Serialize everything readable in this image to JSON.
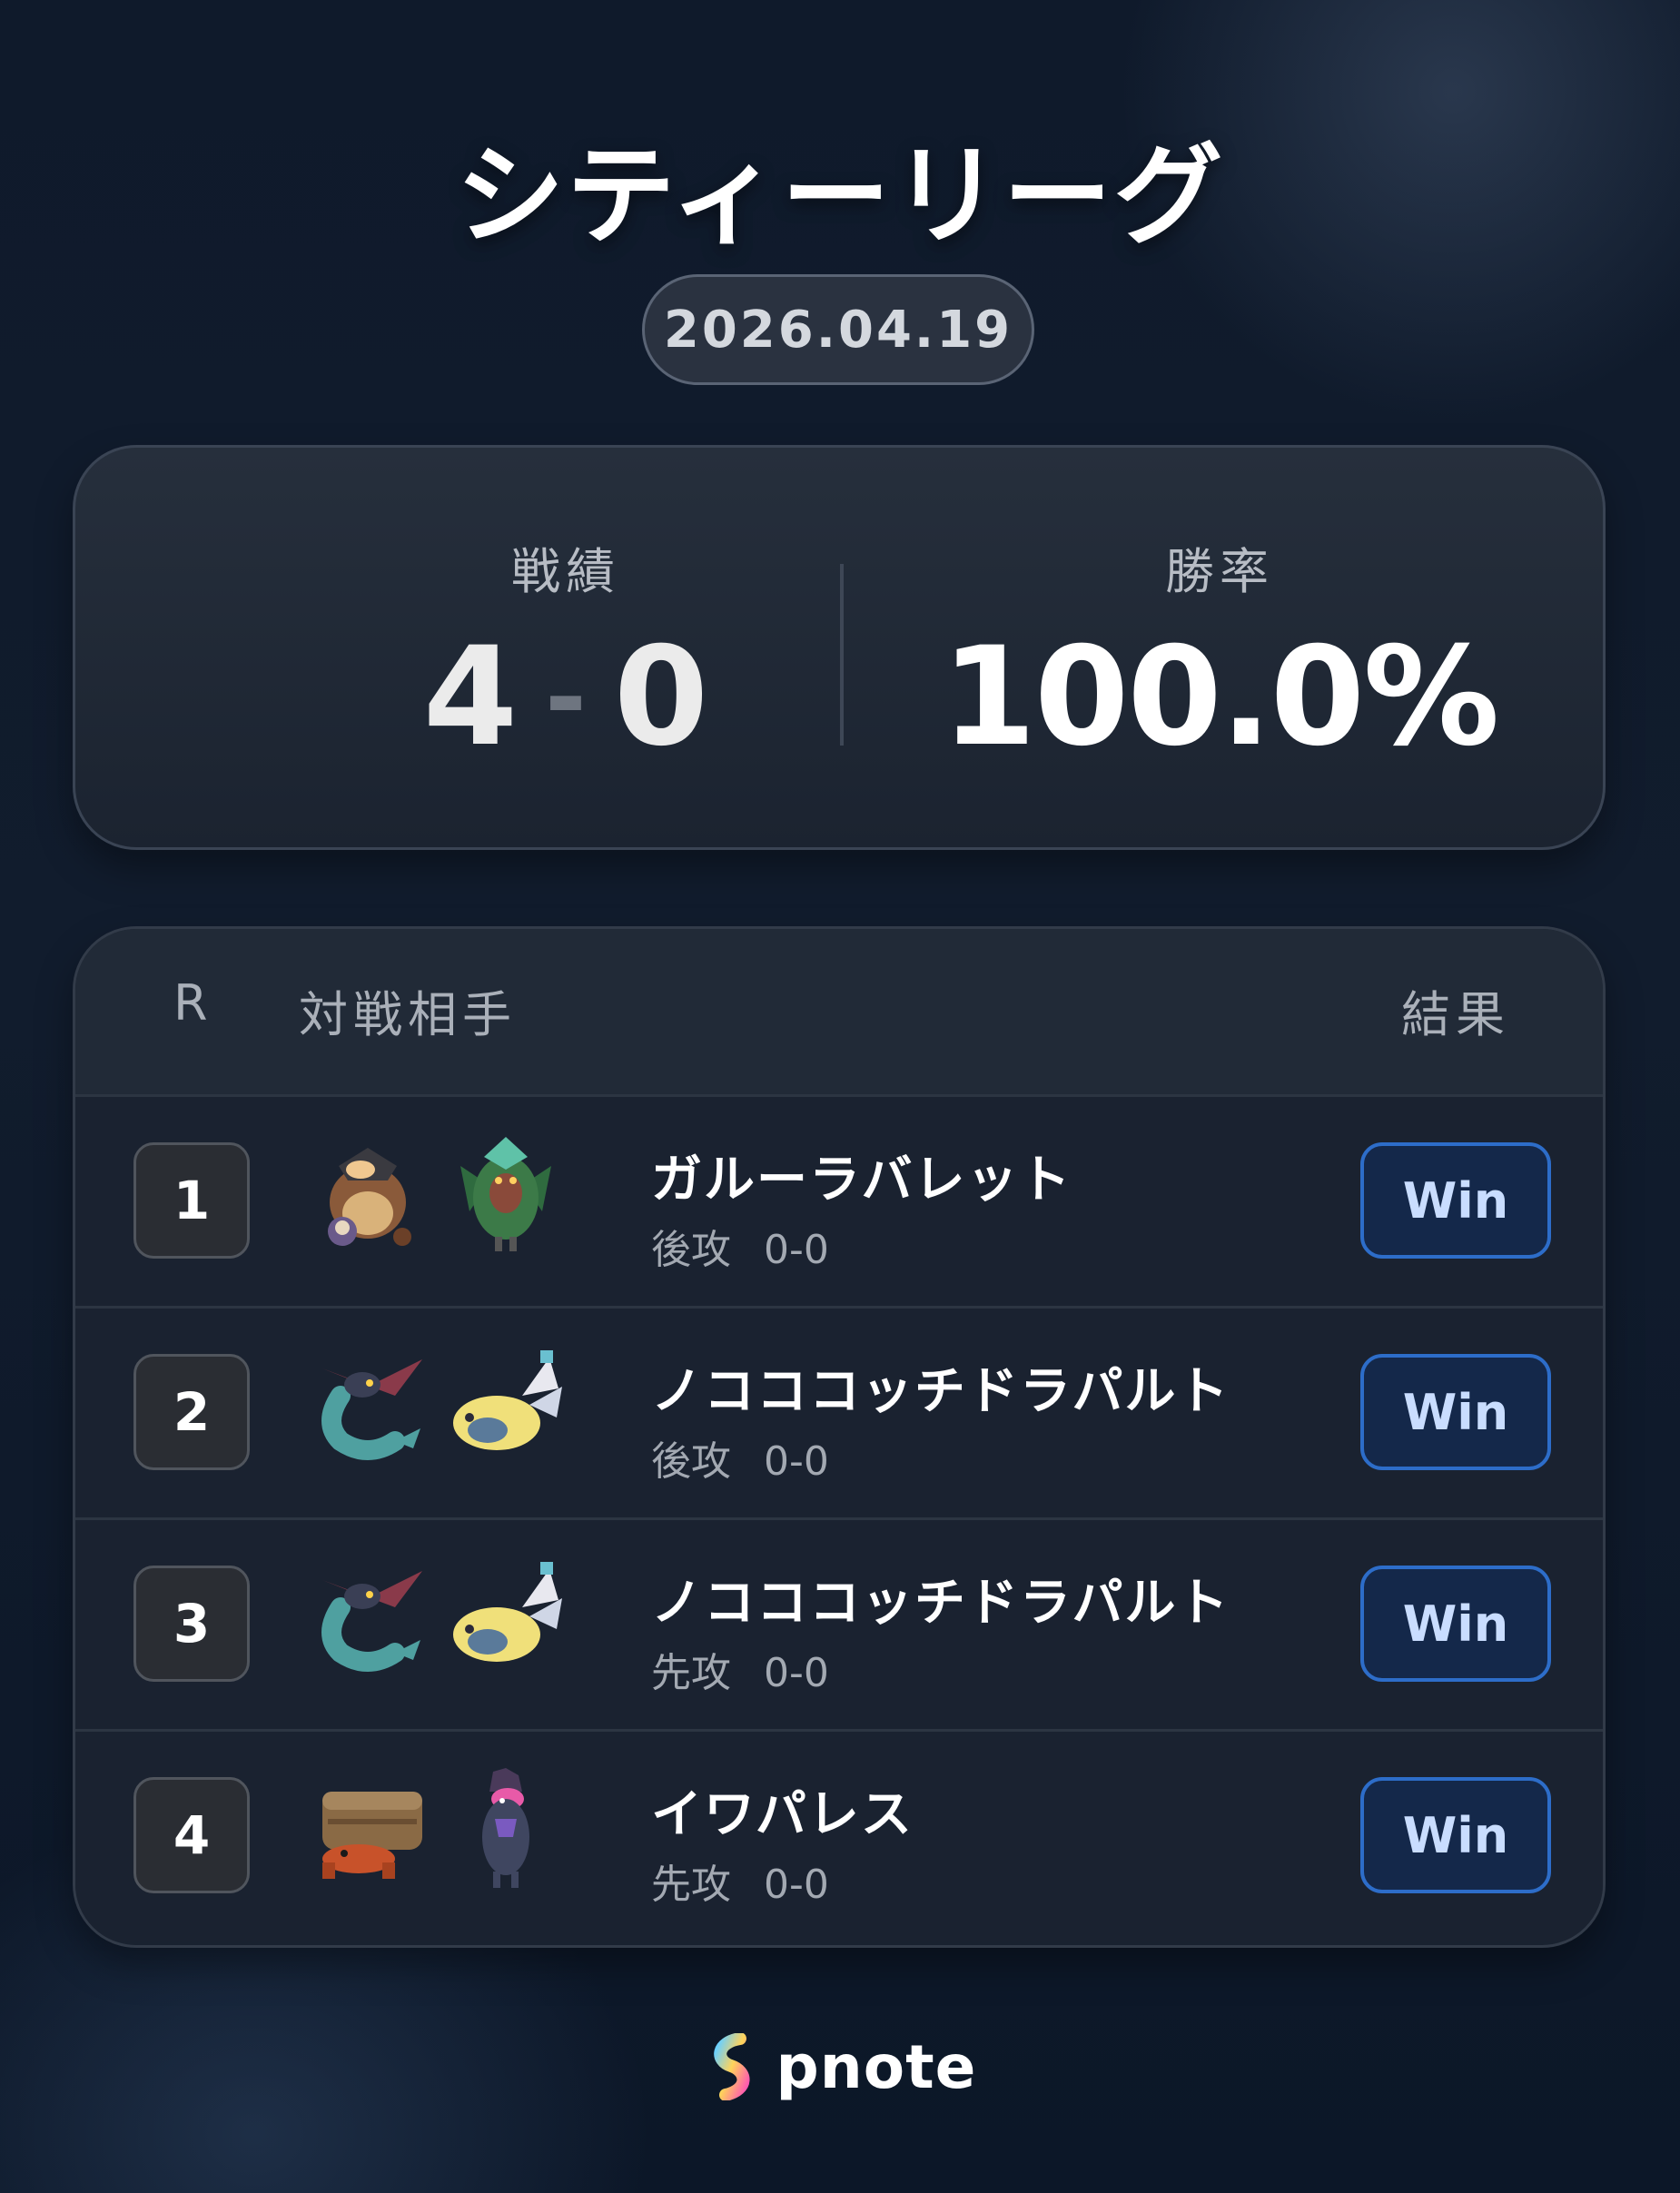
{
  "title": "シティーリーグ",
  "date": "2026.04.19",
  "summary": {
    "record_label": "戦績",
    "wins": "4",
    "dash": "-",
    "losses": "0",
    "rate_label": "勝率",
    "rate_value": "100.0%"
  },
  "table": {
    "header_round": "R",
    "header_opponent": "対戦相手",
    "header_result": "結果",
    "rows": [
      {
        "round": "1",
        "deck": "ガルーラバレット",
        "turn": "後攻",
        "score": "0-0",
        "result": "Win",
        "sprites": [
          "kangaskhan-sprite",
          "decidueye-sprite"
        ]
      },
      {
        "round": "2",
        "deck": "ノコココッチドラパルト",
        "turn": "後攻",
        "score": "0-0",
        "result": "Win",
        "sprites": [
          "dragapult-sprite",
          "dudunsparce-sprite"
        ]
      },
      {
        "round": "3",
        "deck": "ノコココッチドラパルト",
        "turn": "先攻",
        "score": "0-0",
        "result": "Win",
        "sprites": [
          "dragapult-sprite",
          "dudunsparce-sprite"
        ]
      },
      {
        "round": "4",
        "deck": "イワパレス",
        "turn": "先攻",
        "score": "0-0",
        "result": "Win",
        "sprites": [
          "crustle-sprite",
          "grimmsnarl-sprite"
        ]
      }
    ]
  },
  "brand": {
    "name": "pnote",
    "icon": "pnote-logo-icon"
  },
  "colors": {
    "win_accent": "#2d6dc9",
    "background": "#111c2d"
  }
}
